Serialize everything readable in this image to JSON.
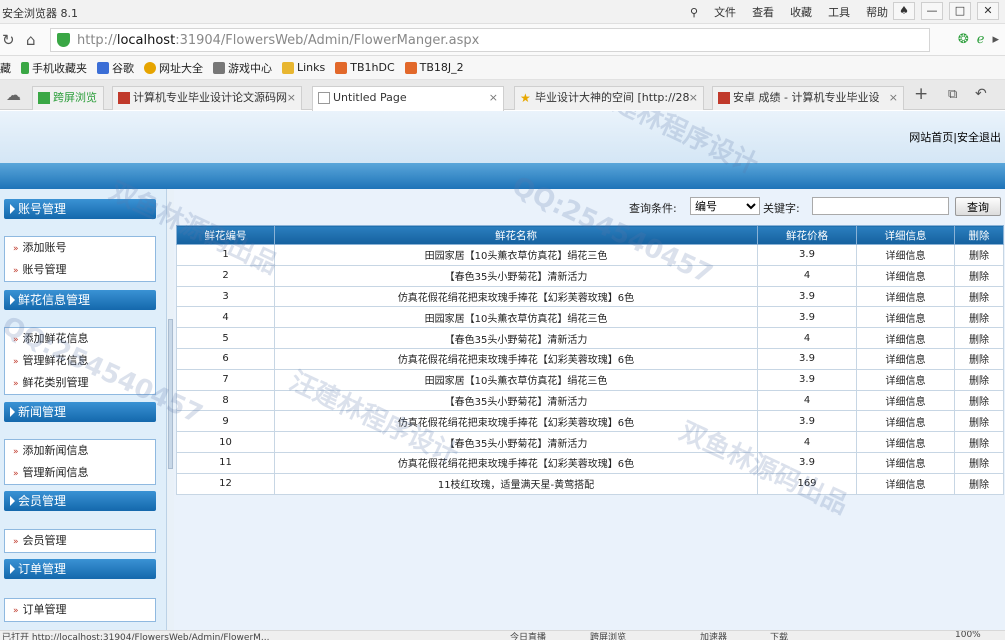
{
  "browser": {
    "app_title": "安全浏览器 8.1",
    "menus": [
      "文件",
      "查看",
      "收藏",
      "工具",
      "帮助"
    ],
    "url_prefix": "http://",
    "url_host": "localhost",
    "url_rest": ":31904/FlowersWeb/Admin/FlowerManger.aspx",
    "favorites_label": "藏",
    "favorites": [
      {
        "label": "手机收藏夹",
        "icon": "phone-icon",
        "color": "#3aa745"
      },
      {
        "label": "谷歌",
        "icon": "google-icon",
        "color": "#3b6ed6"
      },
      {
        "label": "网址大全",
        "icon": "globe-icon",
        "color": "#e6a400"
      },
      {
        "label": "游戏中心",
        "icon": "gamepad-icon",
        "color": "#777777"
      },
      {
        "label": "Links",
        "icon": "folder-icon",
        "color": "#e8b630"
      },
      {
        "label": "TB1hDC",
        "icon": "taobao-icon",
        "color": "#e2682a"
      },
      {
        "label": "TB18J_2",
        "icon": "taobao-icon",
        "color": "#e2682a"
      }
    ],
    "tabs": [
      {
        "label": "跨屏浏览",
        "icon": "phone-icon",
        "active": false
      },
      {
        "label": "计算机专业毕业设计论文源码网",
        "icon": "site-icon",
        "active": false
      },
      {
        "label": "Untitled Page",
        "icon": "page-icon",
        "active": true
      },
      {
        "label": "毕业设计大神的空间 [http://28",
        "icon": "star-icon",
        "active": false
      },
      {
        "label": "安卓 成绩 - 计算机专业毕业设",
        "icon": "site-icon",
        "active": false
      }
    ],
    "new_tab": "+"
  },
  "header": {
    "home_link": "网站首页",
    "separator": "|",
    "logout_link": "安全退出"
  },
  "sidebar": {
    "sections": [
      {
        "title": "账号管理",
        "items": [
          "添加账号",
          "账号管理"
        ]
      },
      {
        "title": "鲜花信息管理",
        "items": [
          "添加鲜花信息",
          "管理鲜花信息",
          "鲜花类别管理"
        ]
      },
      {
        "title": "新闻管理",
        "items": [
          "添加新闻信息",
          "管理新闻信息"
        ]
      },
      {
        "title": "会员管理",
        "items": [
          "会员管理"
        ]
      },
      {
        "title": "订单管理",
        "items": [
          "订单管理"
        ]
      }
    ]
  },
  "search": {
    "condition_label": "查询条件:",
    "selected_field": "编号",
    "keyword_label": "关键字:",
    "keyword_value": "",
    "button_label": "查询"
  },
  "table": {
    "headers": [
      "鲜花编号",
      "鲜花名称",
      "鲜花价格",
      "详细信息",
      "删除"
    ],
    "rows": [
      [
        "1",
        "田园家居【10头薰衣草仿真花】绢花三色",
        "3.9",
        "详细信息",
        "删除"
      ],
      [
        "2",
        "【春色35头小野菊花】清新活力",
        "4",
        "详细信息",
        "删除"
      ],
      [
        "3",
        "仿真花假花绢花把束玫瑰手捧花【幻彩芙蓉玫瑰】6色",
        "3.9",
        "详细信息",
        "删除"
      ],
      [
        "4",
        "田园家居【10头薰衣草仿真花】绢花三色",
        "3.9",
        "详细信息",
        "删除"
      ],
      [
        "5",
        "【春色35头小野菊花】清新活力",
        "4",
        "详细信息",
        "删除"
      ],
      [
        "6",
        "仿真花假花绢花把束玫瑰手捧花【幻彩芙蓉玫瑰】6色",
        "3.9",
        "详细信息",
        "删除"
      ],
      [
        "7",
        "田园家居【10头薰衣草仿真花】绢花三色",
        "3.9",
        "详细信息",
        "删除"
      ],
      [
        "8",
        "【春色35头小野菊花】清新活力",
        "4",
        "详细信息",
        "删除"
      ],
      [
        "9",
        "仿真花假花绢花把束玫瑰手捧花【幻彩芙蓉玫瑰】6色",
        "3.9",
        "详细信息",
        "删除"
      ],
      [
        "10",
        "【春色35头小野菊花】清新活力",
        "4",
        "详细信息",
        "删除"
      ],
      [
        "11",
        "仿真花假花绢花把束玫瑰手捧花【幻彩芙蓉玫瑰】6色",
        "3.9",
        "详细信息",
        "删除"
      ],
      [
        "12",
        "11枝红玫瑰，适量满天星-黄莺搭配",
        "169",
        "详细信息",
        "删除"
      ]
    ]
  },
  "watermarks": [
    "双鱼林源码出品",
    "QQ:254540457",
    "汪建林程序设计"
  ],
  "statusbar": {
    "left": "已打开  http://localhost:31904/FlowersWeb/Admin/FlowerM...",
    "right_items": [
      "今日直播",
      "跨屏浏览",
      "加速器",
      "下载",
      "100%"
    ]
  },
  "colors": {
    "header_blue": "#1e73b8",
    "sidebar_bg": "#dfeefa",
    "table_header": "#15609e"
  }
}
